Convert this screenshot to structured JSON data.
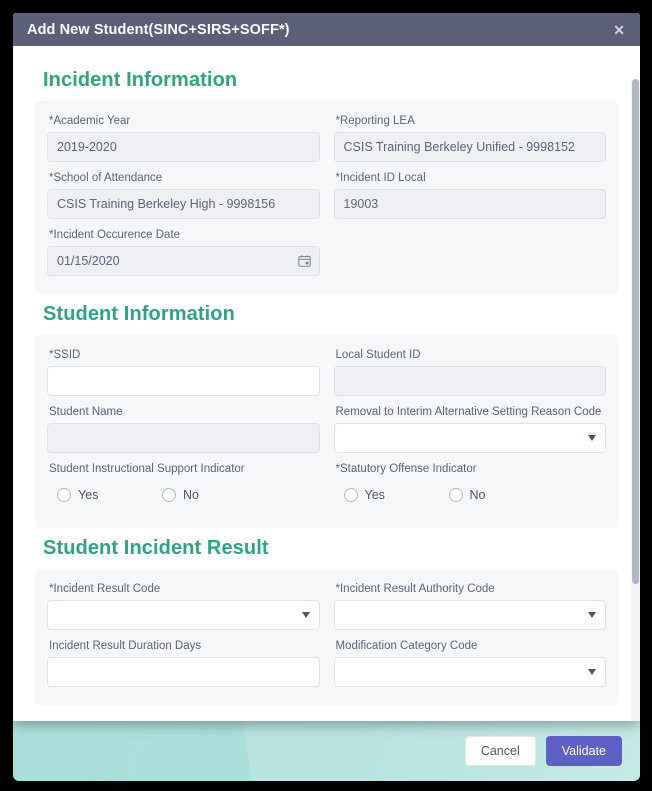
{
  "modal": {
    "title": "Add New Student(SINC+SIRS+SOFF*)",
    "close_icon": "close-icon",
    "close_glyph": "✕"
  },
  "sections": [
    {
      "heading": "Incident Information",
      "fields": [
        {
          "label": "*Academic Year",
          "value": "2019-2020",
          "type": "text-disabled"
        },
        {
          "label": "*Reporting LEA",
          "value": "CSIS Training Berkeley Unified - 9998152",
          "type": "text-disabled"
        },
        {
          "label": "*School of Attendance",
          "value": "CSIS Training Berkeley High - 9998156",
          "type": "text-disabled"
        },
        {
          "label": "*Incident ID Local",
          "value": "19003",
          "type": "text-disabled"
        },
        {
          "label": "*Incident Occurence Date",
          "value": "01/15/2020",
          "type": "date-disabled",
          "icon": "calendar-icon"
        },
        {
          "label": "",
          "value": "",
          "type": "spacer"
        }
      ]
    },
    {
      "heading": "Student Information",
      "fields": [
        {
          "label": "*SSID",
          "value": "",
          "type": "text"
        },
        {
          "label": "Local Student ID",
          "value": "",
          "type": "text-disabled"
        },
        {
          "label": "Student Name",
          "value": "",
          "type": "text-disabled"
        },
        {
          "label": "Removal to Interim Alternative Setting Reason Code",
          "value": "",
          "type": "select"
        },
        {
          "label": "Student Instructional Support Indicator",
          "value": "",
          "type": "radio",
          "options": [
            "Yes",
            "No"
          ]
        },
        {
          "label": "*Statutory Offense Indicator",
          "value": "",
          "type": "radio",
          "options": [
            "Yes",
            "No"
          ]
        }
      ]
    },
    {
      "heading": "Student Incident Result",
      "fields": [
        {
          "label": "*Incident Result Code",
          "value": "",
          "type": "select"
        },
        {
          "label": "*Incident Result Authority Code",
          "value": "",
          "type": "select"
        },
        {
          "label": "Incident Result Duration Days",
          "value": "",
          "type": "text"
        },
        {
          "label": "Modification Category Code",
          "value": "",
          "type": "select"
        }
      ]
    }
  ],
  "footer": {
    "cancel_label": "Cancel",
    "validate_label": "Validate"
  },
  "colors": {
    "header_bg": "#5b5f78",
    "section_heading": "#2ea47f",
    "primary_button": "#5c5fc4",
    "page_backdrop": "#a9dfdb"
  }
}
